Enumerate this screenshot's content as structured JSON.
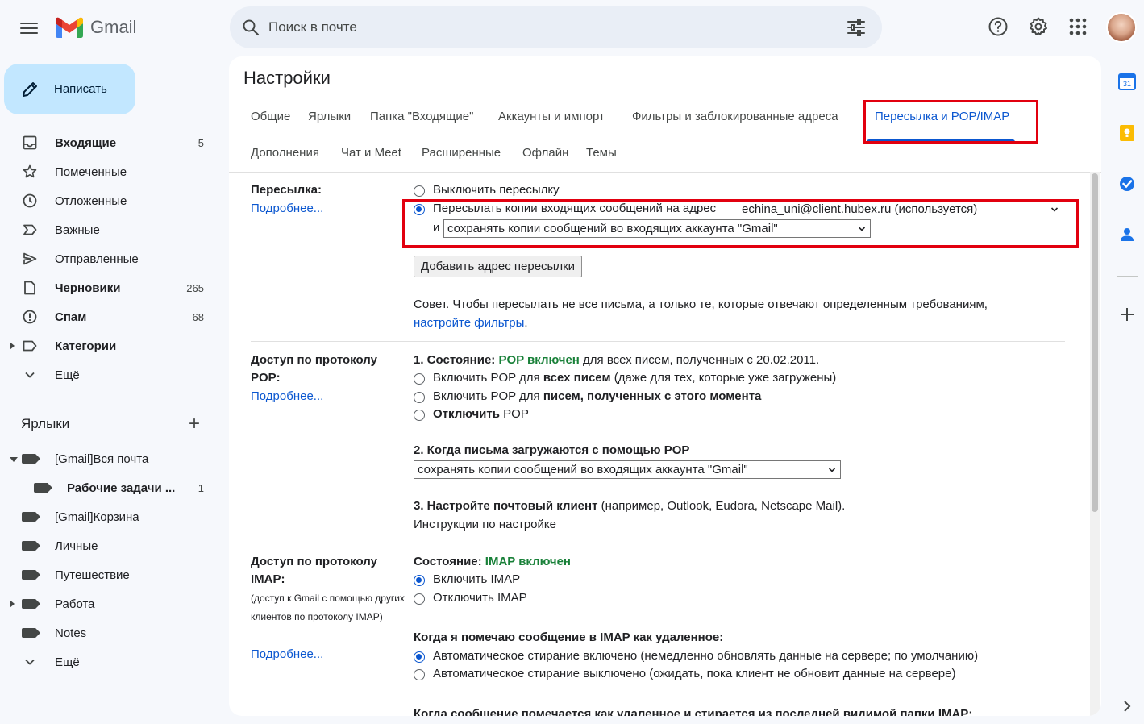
{
  "app": {
    "logo_text": "Gmail"
  },
  "search": {
    "placeholder": "Поиск в почте"
  },
  "compose": {
    "label": "Написать"
  },
  "nav": {
    "items": [
      {
        "label": "Входящие",
        "count": "5",
        "bold": true
      },
      {
        "label": "Помеченные",
        "count": ""
      },
      {
        "label": "Отложенные",
        "count": ""
      },
      {
        "label": "Важные",
        "count": ""
      },
      {
        "label": "Отправленные",
        "count": ""
      },
      {
        "label": "Черновики",
        "count": "265",
        "bold": true
      },
      {
        "label": "Спам",
        "count": "68",
        "bold": true
      },
      {
        "label": "Категории",
        "count": "",
        "bold": true
      },
      {
        "label": "Ещё",
        "count": ""
      }
    ]
  },
  "labels": {
    "title": "Ярлыки",
    "items": [
      {
        "label": "[Gmail]Вся почта",
        "count": ""
      },
      {
        "label": "Рабочие задачи ...",
        "count": "1"
      },
      {
        "label": "[Gmail]Корзина",
        "count": ""
      },
      {
        "label": "Личные",
        "count": ""
      },
      {
        "label": "Путешествие",
        "count": ""
      },
      {
        "label": "Работа",
        "count": ""
      },
      {
        "label": "Notes",
        "count": ""
      },
      {
        "label": "Ещё",
        "count": ""
      }
    ]
  },
  "settings": {
    "title": "Настройки",
    "tabs": [
      "Общие",
      "Ярлыки",
      "Папка \"Входящие\"",
      "Аккаунты и импорт",
      "Фильтры и заблокированные адреса",
      "Пересылка и POP/IMAP",
      "Дополнения",
      "Чат и Meet",
      "Расширенные",
      "Офлайн",
      "Темы"
    ],
    "forwarding": {
      "title": "Пересылка:",
      "more": "Подробнее...",
      "disable": "Выключить пересылку",
      "forward_to": "Пересылать копии входящих сообщений на адрес",
      "address": "echina_uni@client.hubex.ru (используется)",
      "and": "и",
      "keep": "сохранять копии сообщений во входящих аккаунта \"Gmail\"",
      "add_button": "Добавить адрес пересылки",
      "tip": "Совет. Чтобы пересылать не все письма, а только те, которые отвечают определенным требованиям,",
      "tip_link": "настройте фильтры",
      "tip_end": "."
    },
    "pop": {
      "title": "Доступ по протоколу POP:",
      "more": "Подробнее...",
      "status_prefix": "1. Состояние:",
      "status_value": "POP включен",
      "status_suffix": "для всех писем, полученных с 20.02.2011.",
      "opt1_a": "Включить POP для",
      "opt1_b": "всех писем",
      "opt1_c": "(даже для тех, которые уже загружены)",
      "opt2_a": "Включить POP для",
      "opt2_b": "писем, полученных с этого момента",
      "opt3_a": "Отключить",
      "opt3_b": "POP",
      "when_title": "2. Когда письма загружаются с помощью POP",
      "when_select": "сохранять копии сообщений во входящих аккаунта \"Gmail\"",
      "client_title": "3. Настройте почтовый клиент",
      "client_suffix": "(например, Outlook, Eudora, Netscape Mail).",
      "client_link": "Инструкции по настройке"
    },
    "imap": {
      "title": "Доступ по протоколу IMAP:",
      "note": "(доступ к Gmail с помощью других клиентов по протоколу IMAP)",
      "more": "Подробнее...",
      "status_prefix": "Состояние:",
      "status_value": "IMAP включен",
      "enable": "Включить IMAP",
      "disable": "Отключить IMAP",
      "deleted_title": "Когда я помечаю сообщение в IMAP как удаленное:",
      "auto_on": "Автоматическое стирание включено (немедленно обновлять данные на сервере; по умолчанию)",
      "auto_off": "Автоматическое стирание выключено (ожидать, пока клиент не обновит данные на сервере)",
      "last_title": "Когда сообщение помечается как удаленное и стирается из последней видимой папки IMAP:"
    }
  },
  "colors": {
    "accent": "#0b57d0",
    "highlight": "#e2000f",
    "status_green": "#188038",
    "compose_bg": "#c2e7ff"
  }
}
